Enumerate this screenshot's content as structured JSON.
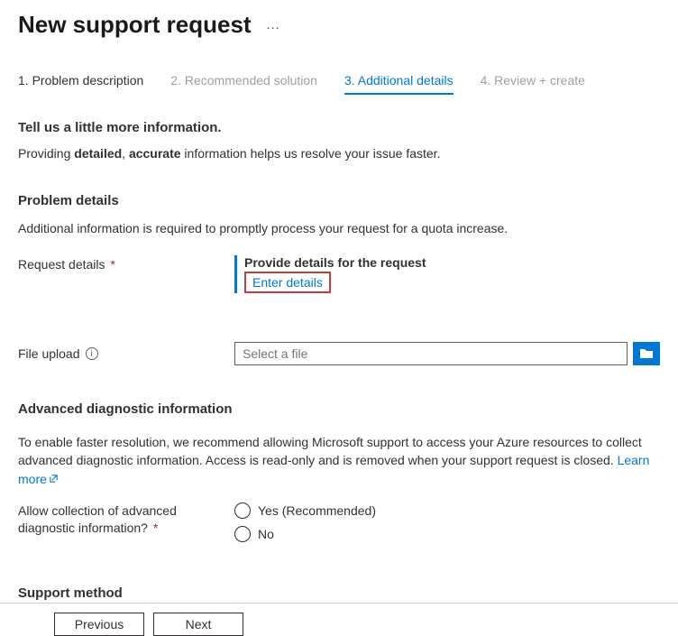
{
  "header": {
    "title": "New support request",
    "more": "…"
  },
  "tabs": {
    "t1": "1. Problem description",
    "t2": "2. Recommended solution",
    "t3": "3. Additional details",
    "t4": "4. Review + create"
  },
  "section": {
    "heading": "Tell us a little more information.",
    "intro_pre": "Providing ",
    "intro_b1": "detailed",
    "intro_sep": ", ",
    "intro_b2": "accurate",
    "intro_post": " information helps us resolve your issue faster."
  },
  "problem": {
    "heading": "Problem details",
    "desc": "Additional information is required to promptly process your request for a quota increase.",
    "request_label": "Request details",
    "provide_label": "Provide details for the request",
    "enter_details": "Enter details"
  },
  "file": {
    "label": "File upload",
    "placeholder": "Select a file"
  },
  "advanced": {
    "heading": "Advanced diagnostic information",
    "desc_main": "To enable faster resolution, we recommend allowing Microsoft support to access your Azure resources to collect advanced diagnostic information. Access is read-only and is removed when your support request is closed. ",
    "learn": "Learn more",
    "allow_label": "Allow collection of advanced diagnostic information?",
    "yes": "Yes (Recommended)",
    "no": "No"
  },
  "support": {
    "heading": "Support method"
  },
  "footer": {
    "prev": "Previous",
    "next": "Next"
  },
  "required_marker": "*"
}
